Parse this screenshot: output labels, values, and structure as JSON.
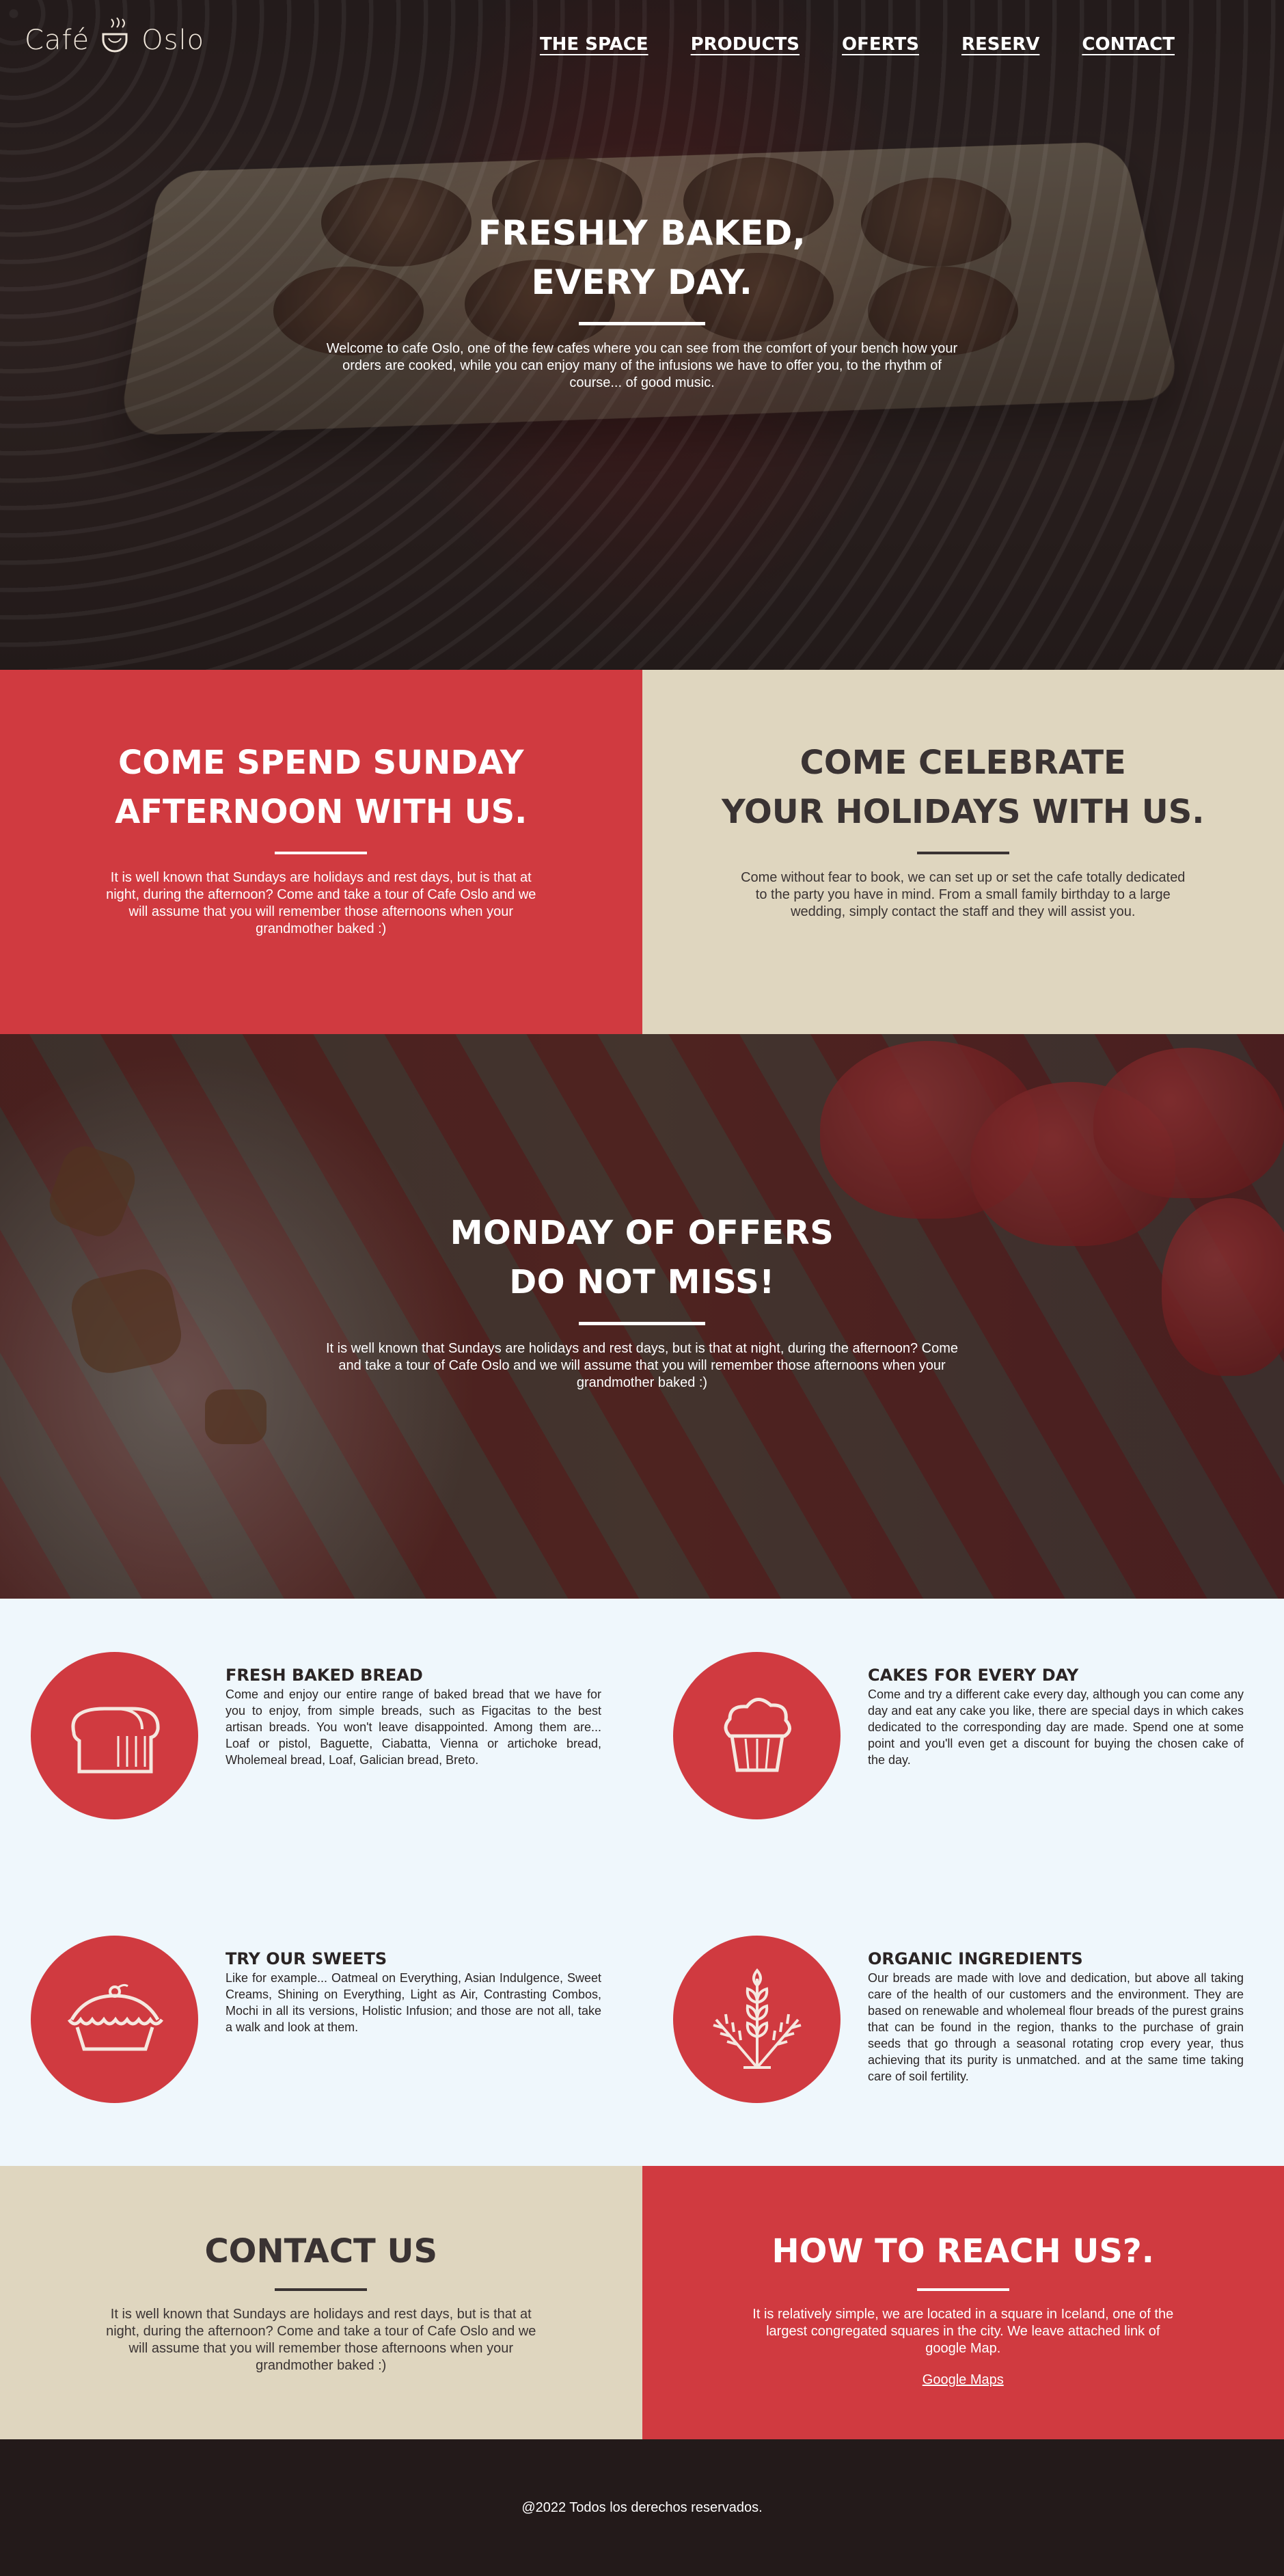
{
  "brand": {
    "name_left": "Café",
    "name_right": "Oslo"
  },
  "nav": {
    "items": [
      "THE SPACE",
      "PRODUCTS",
      "OFERTS",
      "RESERV",
      "CONTACT"
    ]
  },
  "hero": {
    "title_line1": "FRESHLY BAKED,",
    "title_line2": "EVERY DAY.",
    "text": "Welcome to cafe Oslo, one of the few cafes where you can see from the comfort of your bench how your orders are cooked, while you can enjoy many of the infusions we have to offer you, to the rhythm of course... of good music."
  },
  "sunday": {
    "title_line1": "COME SPEND SUNDAY",
    "title_line2": "AFTERNOON WITH US.",
    "text": "It is well known that Sundays are holidays and rest days, but is that at night, during the afternoon? Come and take a tour of Cafe Oslo and we will assume that you will remember those afternoons when your grandmother baked :)"
  },
  "celebrate": {
    "title_line1": "COME CELEBRATE",
    "title_line2": "YOUR HOLIDAYS WITH US.",
    "text": "Come without fear to book, we can set up or set the cafe totally dedicated to the party you have in mind. From a small family birthday to a large wedding, simply contact the staff and they will assist you."
  },
  "offers": {
    "title_line1": "MONDAY OF OFFERS",
    "title_line2": "DO NOT MISS!",
    "text": "It is well known that Sundays are holidays and rest days, but is that at night, during the afternoon? Come and take a tour of Cafe Oslo and we will assume that you will remember those afternoons when your grandmother baked :)"
  },
  "features": [
    {
      "icon": "bread-icon",
      "title": "FRESH BAKED BREAD",
      "text": "Come and enjoy our entire range of baked bread that we have for you to enjoy, from simple breads, such as Figacitas to the best artisan breads. You won't leave disappointed. Among them are... Loaf or pistol, Baguette, Ciabatta, Vienna or artichoke bread, Wholemeal bread, Loaf, Galician bread, Breto."
    },
    {
      "icon": "cupcake-icon",
      "title": "CAKES FOR EVERY DAY",
      "text": "Come and try a different cake every day, although you can come any day and eat any cake you like, there are special days in which cakes dedicated to the corresponding day are made. Spend one at some point and you'll even get a discount for buying the chosen cake of the day."
    },
    {
      "icon": "pie-icon",
      "title": "TRY OUR SWEETS",
      "text": "Like for example... Oatmeal on Everything, Asian Indulgence, Sweet Creams, Shining on Everything, Light as Air, Contrasting Combos, Mochi in all its versions, Holistic Infusion; and those are not all, take a walk and look at them."
    },
    {
      "icon": "wheat-icon",
      "title": "ORGANIC INGREDIENTS",
      "text": "Our breads are made with love and dedication, but above all taking care of the health of our customers and the environment. They are based on renewable and wholemeal flour breads of the purest grains that can be found in the region, thanks to the purchase of grain seeds that go through a seasonal rotating crop every year, thus achieving that its purity is unmatched. and at the same time taking care of soil fertility."
    }
  ],
  "contact": {
    "title": "CONTACT US",
    "text": "It is well known that Sundays are holidays and rest days, but is that at night, during the afternoon? Come and take a tour of Cafe Oslo and we will assume that you will remember those afternoons when your grandmother baked :)"
  },
  "reach": {
    "title": "HOW TO REACH US?.",
    "text": "It is relatively simple, we are located in a square in Iceland, one of the largest congregated squares in the city. We leave attached link of google Map.",
    "link": "Google Maps"
  },
  "footer": {
    "text": "@2022 Todos los derechos reservados."
  },
  "colors": {
    "red": "#d03a40",
    "beige": "#dfd6bf",
    "dark": "#231a1a",
    "light": "#eff7fc",
    "text_dark": "#3a3333"
  }
}
